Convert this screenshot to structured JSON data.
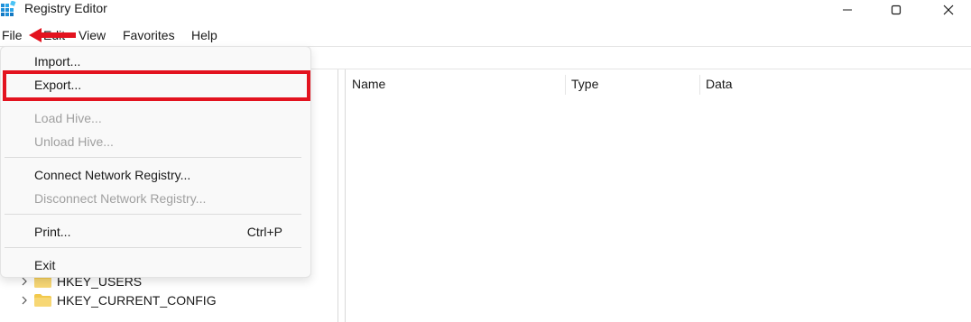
{
  "window": {
    "title": "Registry Editor",
    "icons": {
      "app": "registry-editor-icon",
      "minimize": "minimize-icon",
      "maximize": "maximize-icon",
      "close": "close-icon"
    }
  },
  "menubar": {
    "items": [
      {
        "label": "File"
      },
      {
        "label": "Edit"
      },
      {
        "label": "View"
      },
      {
        "label": "Favorites"
      },
      {
        "label": "Help"
      }
    ]
  },
  "file_menu": {
    "items": [
      {
        "label": "Import...",
        "enabled": true
      },
      {
        "label": "Export...",
        "enabled": true,
        "highlighted": true
      },
      {
        "label": "Load Hive...",
        "enabled": false
      },
      {
        "label": "Unload Hive...",
        "enabled": false
      },
      {
        "label": "Connect Network Registry...",
        "enabled": true
      },
      {
        "label": "Disconnect Network Registry...",
        "enabled": false
      },
      {
        "label": "Print...",
        "enabled": true,
        "shortcut": "Ctrl+P"
      },
      {
        "label": "Exit",
        "enabled": true
      }
    ],
    "highlight_color": "#e3131f"
  },
  "tree": {
    "items": [
      {
        "label": "HKEY_USERS"
      },
      {
        "label": "HKEY_CURRENT_CONFIG"
      }
    ]
  },
  "list": {
    "columns": [
      {
        "label": "Name"
      },
      {
        "label": "Type"
      },
      {
        "label": "Data"
      }
    ]
  },
  "annotation": {
    "arrow_color": "#e3131f"
  }
}
